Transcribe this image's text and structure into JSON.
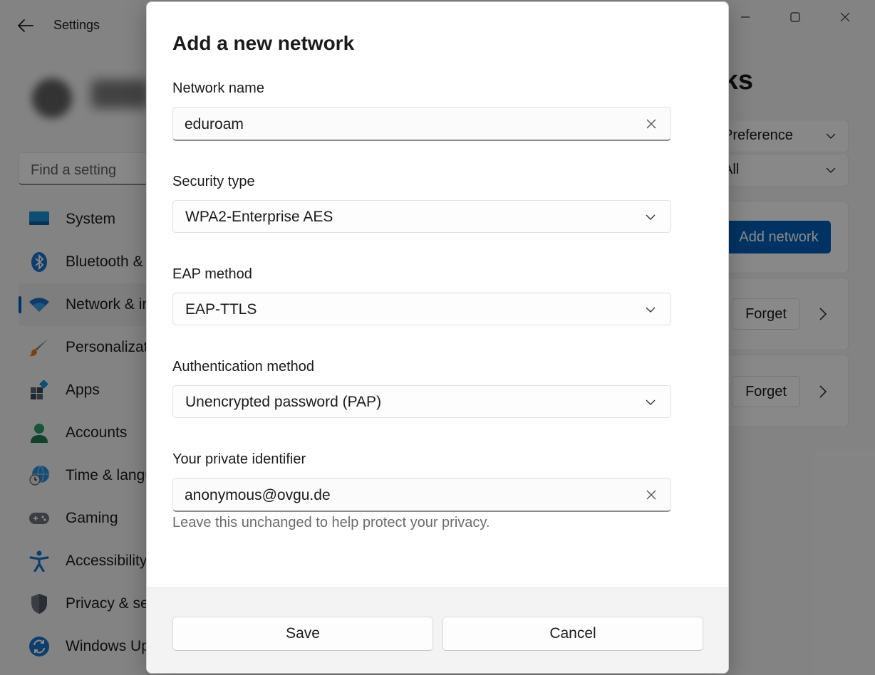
{
  "window": {
    "title": "Settings"
  },
  "search": {
    "placeholder": "Find a setting"
  },
  "sidebar": {
    "items": [
      {
        "label": "System",
        "icon": "monitor-icon",
        "active": false
      },
      {
        "label": "Bluetooth & devices",
        "icon": "bluetooth-icon",
        "active": false
      },
      {
        "label": "Network & internet",
        "icon": "wifi-icon",
        "active": true
      },
      {
        "label": "Personalization",
        "icon": "brush-icon",
        "active": false
      },
      {
        "label": "Apps",
        "icon": "apps-icon",
        "active": false
      },
      {
        "label": "Accounts",
        "icon": "person-icon",
        "active": false
      },
      {
        "label": "Time & language",
        "icon": "globe-clock-icon",
        "active": false
      },
      {
        "label": "Gaming",
        "icon": "gamepad-icon",
        "active": false
      },
      {
        "label": "Accessibility",
        "icon": "accessibility-icon",
        "active": false
      },
      {
        "label": "Privacy & security",
        "icon": "shield-icon",
        "active": false
      },
      {
        "label": "Windows Update",
        "icon": "update-icon",
        "active": false
      }
    ]
  },
  "background_page": {
    "heading": "rks",
    "sort_select": "Preference",
    "filter_select": "All",
    "add_network_label": "Add network",
    "forget_label": "Forget"
  },
  "dialog": {
    "title": "Add a new network",
    "network_name_label": "Network name",
    "network_name_value": "eduroam",
    "security_type_label": "Security type",
    "security_type_value": "WPA2-Enterprise AES",
    "eap_method_label": "EAP method",
    "eap_method_value": "EAP-TTLS",
    "auth_method_label": "Authentication method",
    "auth_method_value": "Unencrypted password (PAP)",
    "private_id_label": "Your private identifier",
    "private_id_value": "anonymous@ovgu.de",
    "private_id_helper": "Leave this unchanged to help protect your privacy.",
    "save_label": "Save",
    "cancel_label": "Cancel"
  },
  "colors": {
    "accent": "#005fb8",
    "overlay": "rgba(0,0,0,0.46)"
  }
}
